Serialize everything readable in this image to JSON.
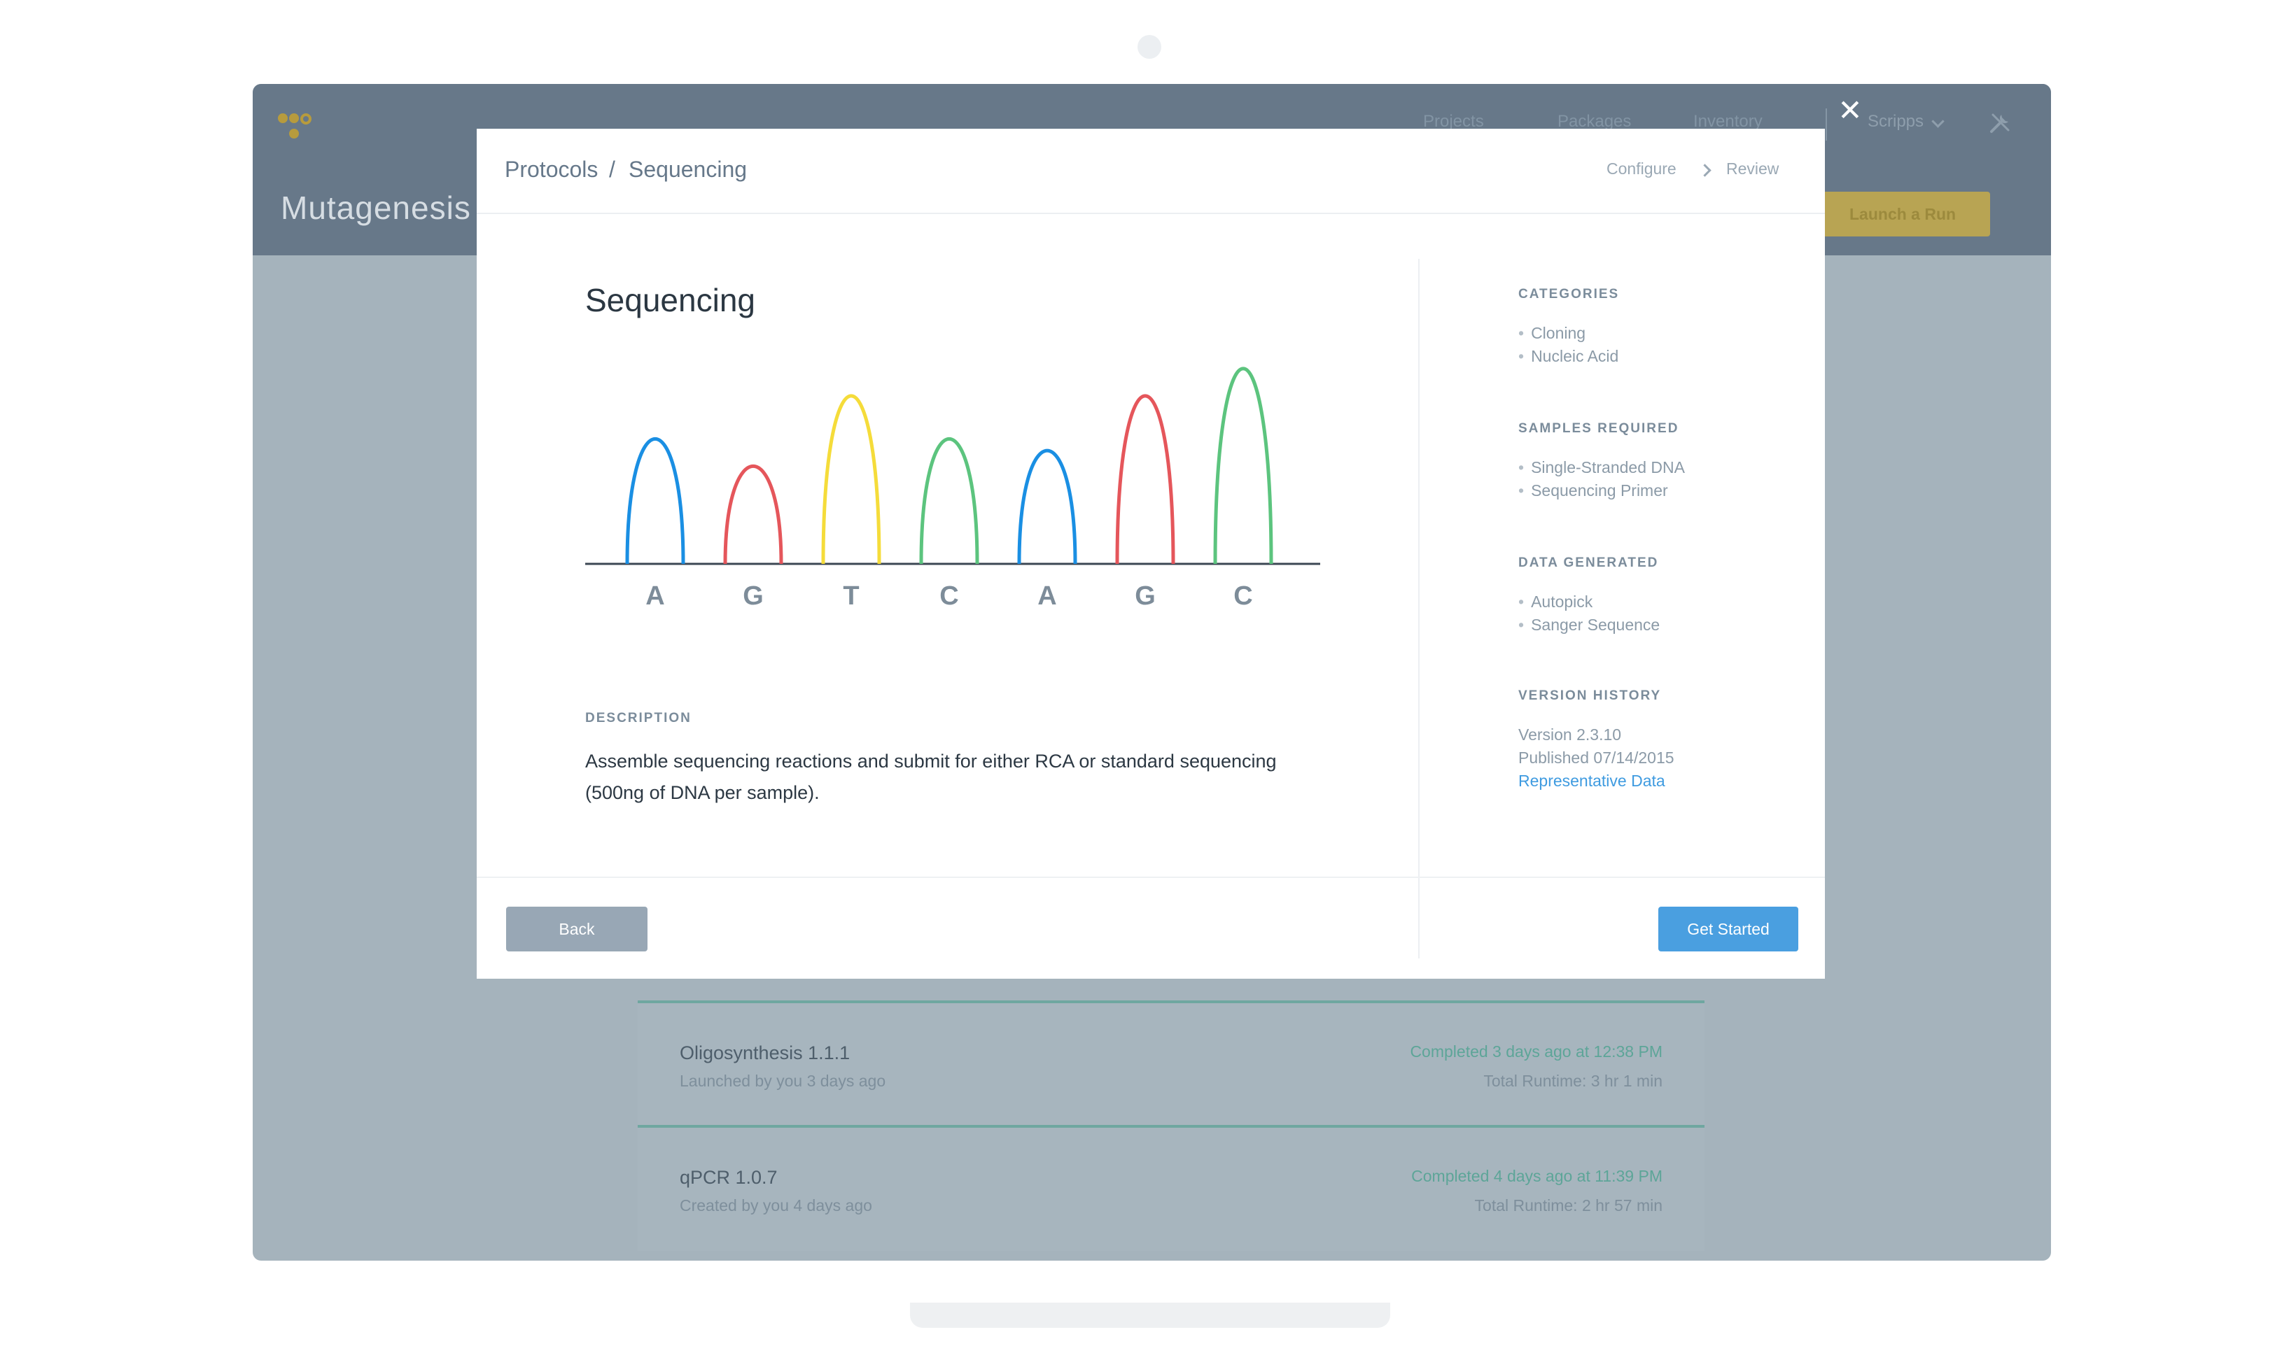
{
  "app": {
    "project_title": "Mutagenesis",
    "nav": [
      "Projects",
      "Packages",
      "Inventory"
    ],
    "org": "Scripps",
    "launch_label": "Launch a Run",
    "runs": [
      {
        "name": "Oligosynthesis 1.1.1",
        "sub": "Launched by you 3 days ago",
        "status": "Completed 3 days ago at 12:38 PM",
        "runtime": "Total Runtime: 3 hr 1 min"
      },
      {
        "name": "qPCR 1.0.7",
        "sub": "Created by you 4 days ago",
        "status": "Completed 4 days ago at 11:39 PM",
        "runtime": "Total Runtime: 2 hr 57 min"
      }
    ]
  },
  "modal": {
    "close_glyph": "✕",
    "breadcrumb": [
      "Protocols",
      "/",
      "Sequencing"
    ],
    "steps": [
      "Configure",
      "Review"
    ],
    "title": "Sequencing",
    "illustration": {
      "bases": [
        "A",
        "G",
        "T",
        "C",
        "A",
        "G",
        "C"
      ],
      "heights": [
        0.64,
        0.5,
        0.86,
        0.64,
        0.58,
        0.86,
        1.0
      ],
      "colors": {
        "A": "#1a8fe3",
        "G": "#e5565b",
        "T": "#f5dc3a",
        "C": "#5cc47e"
      }
    },
    "description_label": "DESCRIPTION",
    "description": "Assemble sequencing reactions and submit for either RCA or standard sequencing (500ng of DNA per sample).",
    "sidebar": {
      "categories_label": "CATEGORIES",
      "categories": [
        "Cloning",
        "Nucleic Acid"
      ],
      "samples_label": "SAMPLES REQUIRED",
      "samples": [
        "Single-Stranded DNA",
        "Sequencing Primer"
      ],
      "data_label": "DATA GENERATED",
      "data": [
        "Autopick",
        "Sanger Sequence"
      ],
      "version_label": "VERSION HISTORY",
      "version": "Version 2.3.10",
      "published": "Published 07/14/2015",
      "link": "Representative Data"
    },
    "back_label": "Back",
    "start_label": "Get Started"
  }
}
